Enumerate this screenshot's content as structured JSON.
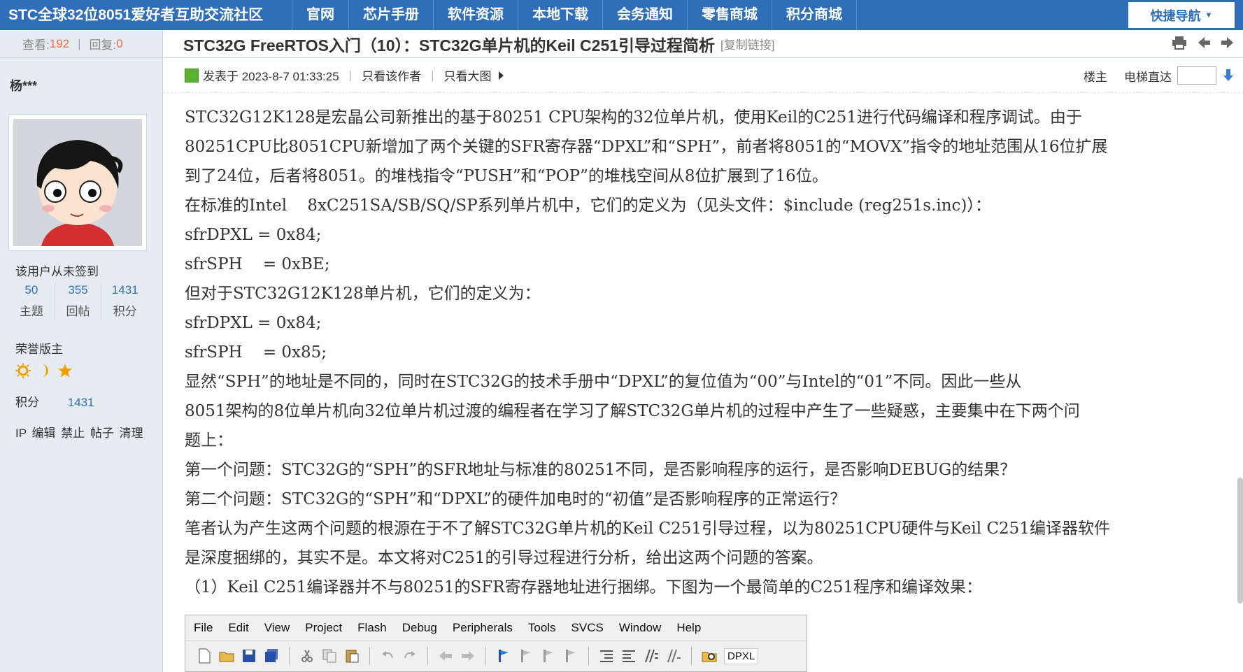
{
  "nav": {
    "site_title": "STC全球32位8051爱好者互助交流社区",
    "items": [
      "官网",
      "芯片手册",
      "软件资源",
      "本地下载",
      "会务通知",
      "零售商城",
      "积分商城"
    ],
    "quick_nav": "快捷导航"
  },
  "sidebar": {
    "views_label": "查看:",
    "views": "192",
    "replies_label": "回复:",
    "replies": "0",
    "author": "杨***",
    "sign_status": "该用户从未签到",
    "stats": [
      {
        "num": "50",
        "label": "主题"
      },
      {
        "num": "355",
        "label": "回帖"
      },
      {
        "num": "1431",
        "label": "积分"
      }
    ],
    "rank": "荣誉版主",
    "points_label": "积分",
    "points_value": "1431",
    "admin_links": "IP 编辑 禁止 帖子 清理"
  },
  "post": {
    "title": "STC32G FreeRTOS入门（10）：STC32G单片机的Keil C251引导过程简析",
    "copy_link": "[复制链接]",
    "posted": "发表于 2023-8-7 01:33:25",
    "only_author": "只看该作者",
    "large_image": "只看大图",
    "floor": "楼主",
    "elevator": "电梯直达",
    "lines": [
      "STC32G12K128是宏晶公司新推出的基于80251 CPU架构的32位单片机，使用Keil的C251进行代码编译和程序调试。由于",
      "80251CPU比8051CPU新增加了两个关键的SFR寄存器“DPXL”和“SPH”，前者将8051的“MOVX”指令的地址范围从16位扩展",
      "到了24位，后者将8051。的堆栈指令“PUSH”和“POP”的堆栈空间从8位扩展到了16位。",
      "在标准的Intel    8xC251SA/SB/SQ/SP系列单片机中，它们的定义为（见头文件：$include (reg251s.inc)）：",
      "sfrDPXL = 0x84;",
      "sfrSPH    = 0xBE;",
      "但对于STC32G12K128单片机，它们的定义为：",
      "sfrDPXL = 0x84;",
      "sfrSPH    = 0x85;",
      "显然“SPH”的地址是不同的，同时在STC32G的技术手册中“DPXL”的复位值为“00”与Intel的“01”不同。因此一些从",
      "8051架构的8位单片机向32位单片机过渡的编程者在学习了解STC32G单片机的过程中产生了一些疑惑，主要集中在下两个问",
      "题上：",
      "第一个问题：STC32G的“SPH”的SFR地址与标准的80251不同，是否影响程序的运行，是否影响DEBUG的结果？",
      "第二个问题：STC32G的“SPH”和“DPXL”的硬件加电时的“初值”是否影响程序的正常运行？",
      "笔者认为产生这两个问题的根源在于不了解STC32G单片机的Keil C251引导过程，以为80251CPU硬件与Keil C251编译器软件",
      "是深度捆绑的，其实不是。本文将对C251的引导过程进行分析，给出这两个问题的答案。",
      "（1）Keil C251编译器并不与80251的SFR寄存器地址进行捆绑。下图为一个最简单的C251程序和编译效果："
    ]
  },
  "ide": {
    "menu": [
      "File",
      "Edit",
      "View",
      "Project",
      "Flash",
      "Debug",
      "Peripherals",
      "Tools",
      "SVCS",
      "Window",
      "Help"
    ],
    "toolbar_text": "DPXL"
  }
}
